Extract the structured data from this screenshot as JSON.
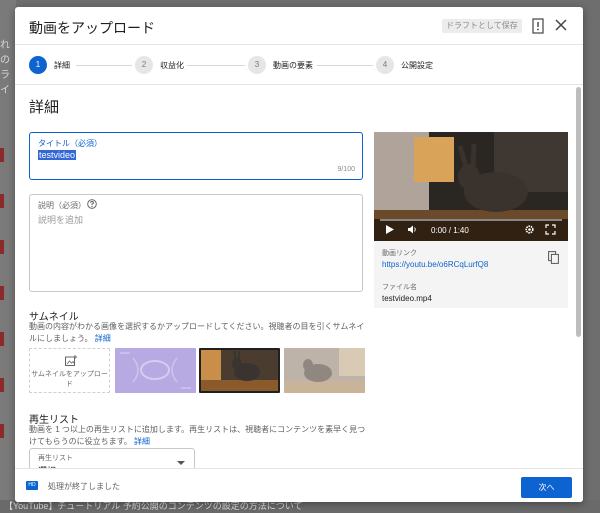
{
  "background": {
    "left_fragments": [
      "れの",
      "ライ"
    ],
    "bottom_text": "【YouTube】チュートリアル 予約公開のコンテンツの設定の方法について"
  },
  "dialog": {
    "title": "動画をアップロード",
    "draft_button": "ドラフトとして保存",
    "close_icon": "close-icon",
    "alert_icon": "alert-icon"
  },
  "stepper": {
    "steps": [
      {
        "num": "1",
        "label": "詳細",
        "active": true
      },
      {
        "num": "2",
        "label": "収益化",
        "active": false
      },
      {
        "num": "3",
        "label": "動画の要素",
        "active": false
      },
      {
        "num": "4",
        "label": "公開設定",
        "active": false
      }
    ]
  },
  "details": {
    "section_title": "詳細",
    "title_field": {
      "label": "タイトル（必須）",
      "value": "testvideo",
      "count": "9/100"
    },
    "description_field": {
      "label": "説明（必須）",
      "placeholder": "説明を追加"
    },
    "thumbnail": {
      "title": "サムネイル",
      "desc": "動画の内容がわかる画像を選択するかアップロードしてください。視聴者の目を引くサムネイルにしましょう。",
      "link": "詳細",
      "upload_label": "サムネイルをアップロード"
    },
    "playlist": {
      "title": "再生リスト",
      "desc": "動画を 1 つ以上の再生リストに追加します。再生リストは、視聴者にコンテンツを素早く見つけてもらうのに役立ちます。",
      "link": "詳細",
      "select_label": "再生リスト",
      "select_value": "選択"
    }
  },
  "video": {
    "time": "0:00 / 1:40",
    "link_label": "動画リンク",
    "link_url": "https://youtu.be/o6RCqLurfQ8",
    "file_label": "ファイル名",
    "file_name": "testvideo.mp4",
    "progress": 0
  },
  "footer": {
    "status": "処理が終了しました",
    "hd_badge": "HD",
    "next_button": "次へ"
  },
  "colors": {
    "accent": "#0d63cf",
    "overlay": "#6e6e6e"
  }
}
